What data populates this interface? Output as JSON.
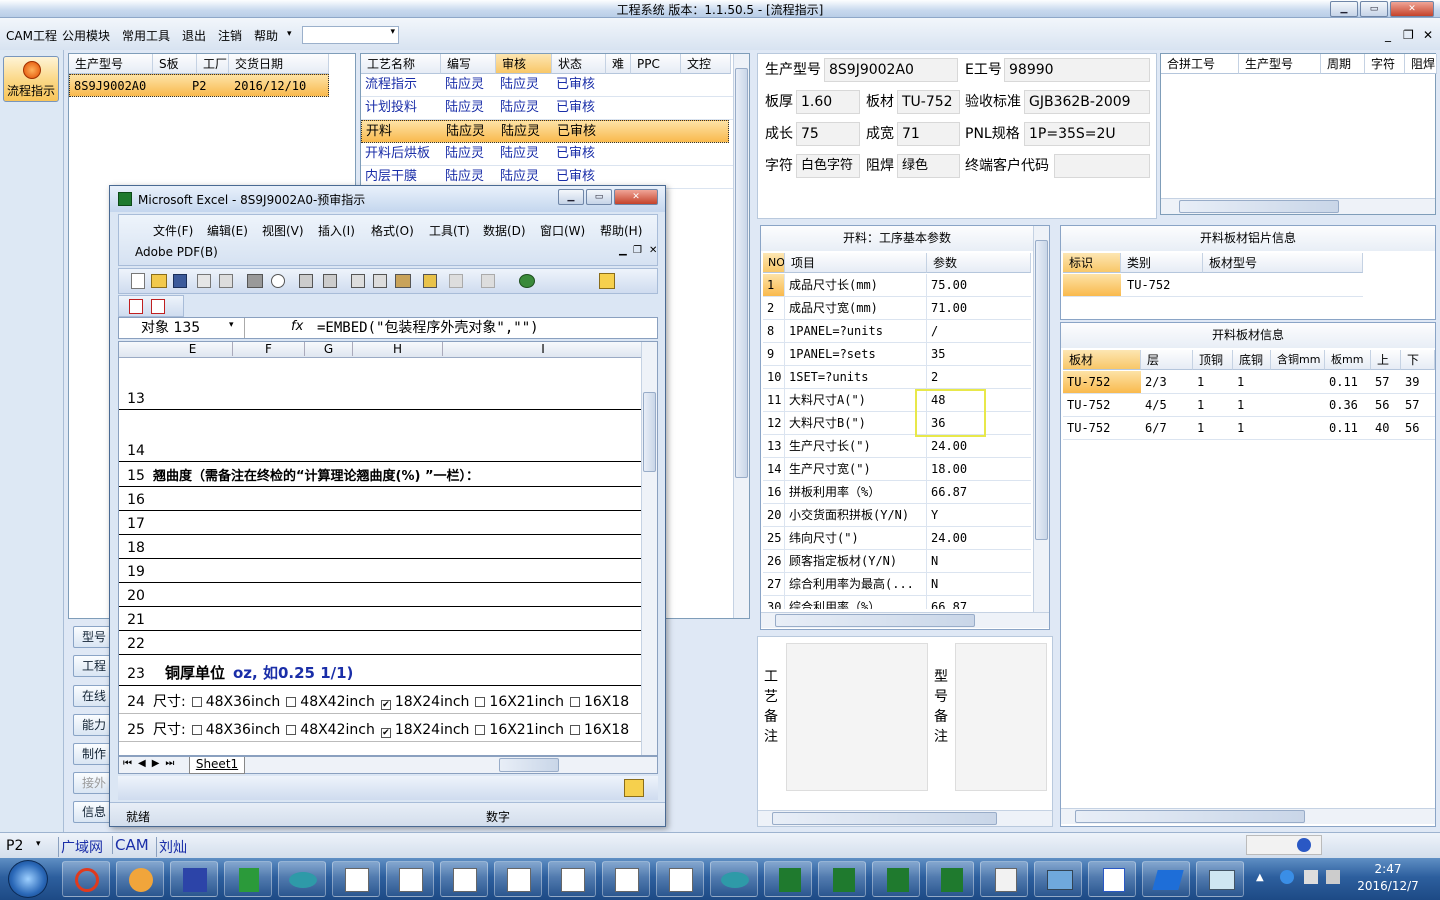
{
  "window": {
    "title": "工程系统   版本：1.1.50.5 - [流程指示]",
    "min": "▁",
    "max": "▭",
    "close": "✕"
  },
  "menu": {
    "items": [
      "CAM工程",
      "公用模块",
      "常用工具",
      "退出",
      "注销",
      "帮助"
    ],
    "dropdown_arrow": "▾"
  },
  "toolbar_right": {
    "min": "_",
    "restore": "❐",
    "close": "✕"
  },
  "sidebar": {
    "flow_label": "流程指示",
    "buttons": [
      "型号",
      "工程",
      "在线",
      "能力",
      "制作",
      "接外",
      "信息"
    ]
  },
  "order_table": {
    "headers": [
      "生产型号",
      "S板",
      "工厂",
      "交货日期"
    ],
    "rows": [
      {
        "model": "8S9J9002A0",
        "sboard": "",
        "factory": "P2",
        "date": "2016/12/10"
      }
    ]
  },
  "process_table": {
    "headers": [
      "工艺名称",
      "编写",
      "审核",
      "状态",
      "难",
      "PPC",
      "文控"
    ],
    "rows": [
      {
        "name": "流程指示",
        "writer": "陆应灵",
        "reviewer": "陆应灵",
        "status": "已审核"
      },
      {
        "name": "计划投料",
        "writer": "陆应灵",
        "reviewer": "陆应灵",
        "status": "已审核"
      },
      {
        "name": "开料",
        "writer": "陆应灵",
        "reviewer": "陆应灵",
        "status": "已审核"
      },
      {
        "name": "开料后烘板",
        "writer": "陆应灵",
        "reviewer": "陆应灵",
        "status": "已审核"
      },
      {
        "name": "内层干膜",
        "writer": "陆应灵",
        "reviewer": "陆应灵",
        "status": "已审核"
      }
    ]
  },
  "info": {
    "labels": {
      "model": "生产型号",
      "eno": "E工号",
      "thickness": "板厚",
      "material": "板材",
      "standard": "验收标准",
      "length": "成长",
      "width": "成宽",
      "pnl": "PNL规格",
      "char": "字符",
      "mask": "阻焊",
      "customer": "终端客户代码"
    },
    "values": {
      "model": "8S9J9002A0",
      "eno": "98990",
      "thickness": "1.60",
      "material": "TU-752",
      "standard": "GJB362B-2009",
      "length": "75",
      "width": "71",
      "pnl": "1P=35S=2U",
      "char": "白色字符",
      "mask": "绿色",
      "customer": ""
    }
  },
  "combine_table": {
    "headers": [
      "合拼工号",
      "生产型号",
      "周期",
      "字符",
      "阻焊"
    ]
  },
  "params": {
    "title": "开料：工序基本参数",
    "headers": [
      "NO",
      "项目",
      "参数"
    ],
    "rows": [
      {
        "no": "1",
        "item": "成品尺寸长(mm)",
        "value": "75.00"
      },
      {
        "no": "2",
        "item": "成品尺寸宽(mm)",
        "value": "71.00"
      },
      {
        "no": "8",
        "item": "1PANEL=?units",
        "value": "/"
      },
      {
        "no": "9",
        "item": "1PANEL=?sets",
        "value": "35"
      },
      {
        "no": "10",
        "item": "1SET=?units",
        "value": "2"
      },
      {
        "no": "11",
        "item": "大料尺寸A(\")",
        "value": "48"
      },
      {
        "no": "12",
        "item": "大料尺寸B(\")",
        "value": "36"
      },
      {
        "no": "13",
        "item": "生产尺寸长(\")",
        "value": "24.00"
      },
      {
        "no": "14",
        "item": "生产尺寸宽(\")",
        "value": "18.00"
      },
      {
        "no": "16",
        "item": "拼板利用率（%）",
        "value": "66.87"
      },
      {
        "no": "20",
        "item": "小交货面积拼板(Y/N)",
        "value": "Y"
      },
      {
        "no": "25",
        "item": "纬向尺寸(\")",
        "value": "24.00"
      },
      {
        "no": "26",
        "item": "顾客指定板材(Y/N)",
        "value": "N"
      },
      {
        "no": "27",
        "item": "综合利用率为最高(...",
        "value": "N"
      },
      {
        "no": "30",
        "item": "综合利用率（%）",
        "value": "66.87"
      }
    ]
  },
  "sheet_pic": {
    "title": "开料板材铝片信息",
    "headers": [
      "标识",
      "类别",
      "板材型号"
    ],
    "rows": [
      {
        "mark": "",
        "type": "TU-752",
        "model": ""
      }
    ]
  },
  "sheet_info": {
    "title": "开料板材信息",
    "headers": [
      "板材",
      "层",
      "顶铜",
      "底铜",
      "含铜mm",
      "板mm",
      "上",
      "下"
    ],
    "rows": [
      {
        "m": "TU-752",
        "layer": "2/3",
        "top": "1",
        "bottom": "1",
        "cu": "",
        "board": "0.11",
        "up": "57",
        "down": "39"
      },
      {
        "m": "TU-752",
        "layer": "4/5",
        "top": "1",
        "bottom": "1",
        "cu": "",
        "board": "0.36",
        "up": "56",
        "down": "57"
      },
      {
        "m": "TU-752",
        "layer": "6/7",
        "top": "1",
        "bottom": "1",
        "cu": "",
        "board": "0.11",
        "up": "40",
        "down": "56"
      }
    ]
  },
  "remarks": {
    "process": "工艺备注",
    "model": "型号备注"
  },
  "excel": {
    "title": "Microsoft Excel - 8S9J9002A0-预审指示",
    "menus": [
      "文件(F)",
      "编辑(E)",
      "视图(V)",
      "插入(I)",
      "格式(O)",
      "工具(T)",
      "数据(D)",
      "窗口(W)",
      "帮助(H)"
    ],
    "adobe": "Adobe PDF(B)",
    "namebox": "对象 135",
    "fx": "fx",
    "formula": "=EMBED(\"包装程序外壳对象\",\"\")",
    "columns": [
      "E",
      "F",
      "G",
      "H",
      "I"
    ],
    "rows": [
      {
        "n": "13",
        "text": ""
      },
      {
        "n": "14",
        "text": ""
      },
      {
        "n": "15",
        "text": "翘曲度（需备注在终检的“计算理论翘曲度(%) ”一栏）："
      },
      {
        "n": "16",
        "text": ""
      },
      {
        "n": "17",
        "text": ""
      },
      {
        "n": "18",
        "text": ""
      },
      {
        "n": "19",
        "text": ""
      },
      {
        "n": "20",
        "text": ""
      },
      {
        "n": "21",
        "text": ""
      },
      {
        "n": "22",
        "text": ""
      }
    ],
    "row23": {
      "n": "23",
      "label": "铜厚单位",
      "unit": "oz, 如0.25 1/1)"
    },
    "row24": {
      "n": "24",
      "prefix": "尺寸:",
      "options": [
        "48X36inch",
        "48X42inch",
        "18X24inch",
        "16X21inch",
        "16X18"
      ]
    },
    "row25": {
      "n": "25",
      "prefix": "尺寸:",
      "options": [
        "48X36inch",
        "48X42inch",
        "18X24inch",
        "16X21inch",
        "16X18"
      ]
    },
    "checked": "✔",
    "sheet_tab": "Sheet1",
    "status": "就绪",
    "status_num": "数字"
  },
  "statusbar": {
    "plant": "P2",
    "items": [
      "广域网",
      "CAM",
      "刘灿"
    ]
  },
  "clock": {
    "time": "2:47",
    "date": "2016/12/7"
  },
  "colors": {
    "accent": "#f9b94d",
    "link": "#1a2ea8",
    "highlight_box": "#e8e84a"
  }
}
